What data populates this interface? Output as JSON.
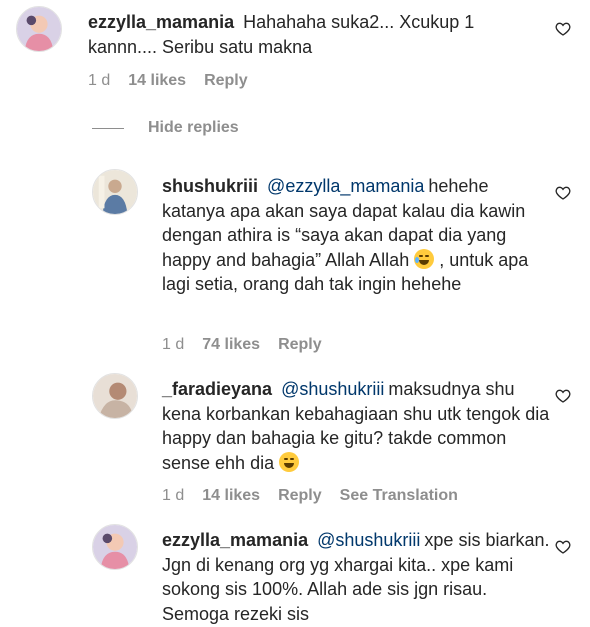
{
  "comments": [
    {
      "username": "ezzylla_mamania",
      "mention": "",
      "text": "Hahahaha suka2... Xcukup 1 kannn.... Seribu satu makna",
      "time": "1 d",
      "likes": "14 likes",
      "reply": "Reply",
      "translation": ""
    },
    {
      "username": "shushukriii",
      "mention": "@ezzylla_mamania",
      "text": "hehehe katanya apa akan saya dapat kalau dia kawin dengan athira is “saya akan dapat dia yang happy and bahagia” Allah Allah",
      "text_after_emoji": ", untuk apa lagi setia, orang dah tak ingin hehehe",
      "time": "1 d",
      "likes": "74 likes",
      "reply": "Reply",
      "translation": ""
    },
    {
      "username": "_faradieyana",
      "mention": "@shushukriii",
      "text": "maksudnya shu kena korbankan kebahagiaan shu utk tengok dia happy dan bahagia ke gitu? takde common sense ehh dia",
      "time": "1 d",
      "likes": "14 likes",
      "reply": "Reply",
      "translation": "See Translation"
    },
    {
      "username": "ezzylla_mamania",
      "mention": "@shushukriii",
      "text": "xpe sis biarkan. Jgn di kenang org yg xhargai kita.. xpe kami sokong sis 100%. Allah ade sis jgn risau. Semoga rezeki sis",
      "time": "",
      "likes": "",
      "reply": "",
      "translation": ""
    }
  ],
  "hide_replies": "Hide replies",
  "icons": {
    "like": "heart-outline-icon",
    "laugh": "laughing-tears-emoji",
    "grin": "grinning-sweat-emoji"
  }
}
